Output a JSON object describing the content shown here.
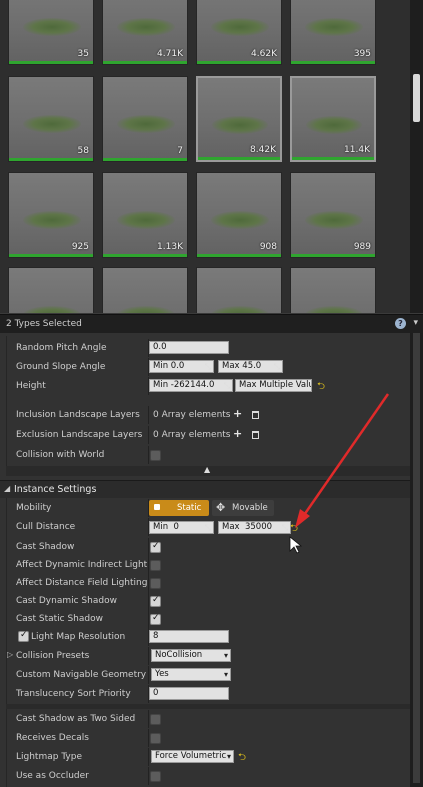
{
  "thumbnails": [
    {
      "count": "35"
    },
    {
      "count": "4.71K"
    },
    {
      "count": "4.62K"
    },
    {
      "count": "395"
    },
    {
      "count": "58"
    },
    {
      "count": "7"
    },
    {
      "count": "8.42K",
      "selected": true
    },
    {
      "count": "11.4K",
      "selected": true
    },
    {
      "count": "925"
    },
    {
      "count": "1.13K"
    },
    {
      "count": "908"
    },
    {
      "count": "989"
    },
    {
      "count": ""
    },
    {
      "count": ""
    },
    {
      "count": ""
    },
    {
      "count": ""
    }
  ],
  "header": {
    "title": "2 Types Selected",
    "help_icon": "?"
  },
  "props": {
    "random_pitch": {
      "label": "Random Pitch Angle",
      "value": "0.0"
    },
    "ground_slope": {
      "label": "Ground Slope Angle",
      "min_label": "Min",
      "min": "0.0",
      "max_label": "Max",
      "max": "45.0"
    },
    "height": {
      "label": "Height",
      "min_label": "Min",
      "min": "-262144.0",
      "max_label": "Max",
      "max": "Multiple Values"
    },
    "inclusion": {
      "label": "Inclusion Landscape Layers",
      "value": "0 Array elements"
    },
    "exclusion": {
      "label": "Exclusion Landscape Layers",
      "value": "0 Array elements"
    },
    "collision_world": {
      "label": "Collision with World",
      "checked": false
    }
  },
  "instance_settings": {
    "title": "Instance Settings",
    "mobility": {
      "label": "Mobility",
      "static": "Static",
      "movable": "Movable"
    },
    "cull_distance": {
      "label": "Cull Distance",
      "min_label": "Min",
      "min": "0",
      "max_label": "Max",
      "max": "35000"
    },
    "cast_shadow": {
      "label": "Cast Shadow",
      "checked": true
    },
    "dyn_indirect": {
      "label": "Affect Dynamic Indirect Lighting",
      "checked": false
    },
    "dist_field": {
      "label": "Affect Distance Field Lighting",
      "checked": false
    },
    "cast_dyn_shadow": {
      "label": "Cast Dynamic Shadow",
      "checked": true
    },
    "cast_static_shadow": {
      "label": "Cast Static Shadow",
      "checked": true
    },
    "light_map": {
      "label": "Light Map Resolution",
      "value": "8",
      "checked": true
    },
    "collision_presets": {
      "label": "Collision Presets",
      "value": "NoCollision"
    },
    "nav_geometry": {
      "label": "Custom Navigable Geometry",
      "value": "Yes"
    },
    "translucency": {
      "label": "Translucency Sort Priority",
      "value": "0"
    },
    "two_sided": {
      "label": "Cast Shadow as Two Sided",
      "checked": false
    },
    "receives_decals": {
      "label": "Receives Decals",
      "checked": false
    },
    "lightmap_type": {
      "label": "Lightmap Type",
      "value": "Force Volumetric"
    },
    "occluder": {
      "label": "Use as Occluder",
      "checked": false
    }
  },
  "colors": {
    "accent_static": "#c98b19",
    "annotation_arrow": "#e02a2a",
    "count_bar": "#2fa52f"
  }
}
